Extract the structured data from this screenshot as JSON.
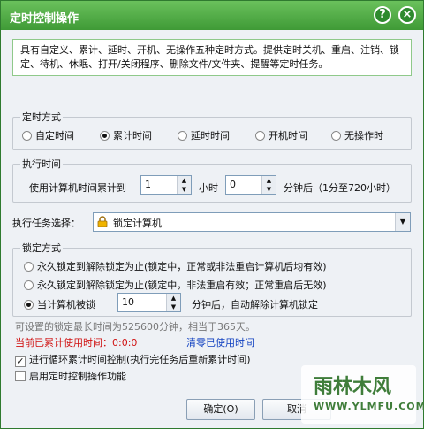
{
  "window": {
    "title": "定时控制操作",
    "help_glyph": "?",
    "close_glyph": "×"
  },
  "description": "具有自定义、累计、延时、开机、无操作五种定时方式。提供定时关机、重启、注销、锁定、待机、休眠、打开/关闭程序、删除文件/文件夹、提醒等定时任务。",
  "timing_mode": {
    "legend": "定时方式",
    "options": [
      "自定时间",
      "累计时间",
      "延时时间",
      "开机时间",
      "无操作时"
    ],
    "selected": "累计时间"
  },
  "execute_time": {
    "legend": "执行时间",
    "prefix": "使用计算机时间累计到",
    "hours_value": "1",
    "hours_unit": "小时",
    "minutes_value": "0",
    "suffix": "分钟后（1分至720小时）"
  },
  "task": {
    "label": "执行任务选择：",
    "selected": "锁定计算机"
  },
  "lock_mode": {
    "legend": "锁定方式",
    "option1": "永久锁定到解除锁定为止(锁定中，正常或非法重启计算机后均有效)",
    "option2": "永久锁定到解除锁定为止(锁定中，非法重启有效；正常重启后无效)",
    "option3_prefix": "当计算机被锁",
    "option3_value": "10",
    "option3_suffix": "分钟后，自动解除计算机锁定",
    "selected": 3
  },
  "info_note": "可设置的锁定最长时间为525600分钟，相当于365天。",
  "usage": {
    "current": "当前已累计使用时间：0:0:0",
    "reset_link": "清零已使用时间"
  },
  "checks": {
    "loop": {
      "label": "进行循环累计时间控制(执行完任务后重新累计时间)",
      "checked": true
    },
    "enable": {
      "label": "启用定时控制操作功能",
      "checked": false
    }
  },
  "buttons": {
    "ok": "确定(O)",
    "cancel": "取消"
  },
  "watermark": {
    "name": "雨林木风",
    "url": "WWW.YLMFU.COM"
  },
  "colors": {
    "titlebar": "#4fae43",
    "current_usage": "#d01010",
    "reset_link": "#1040c0"
  }
}
